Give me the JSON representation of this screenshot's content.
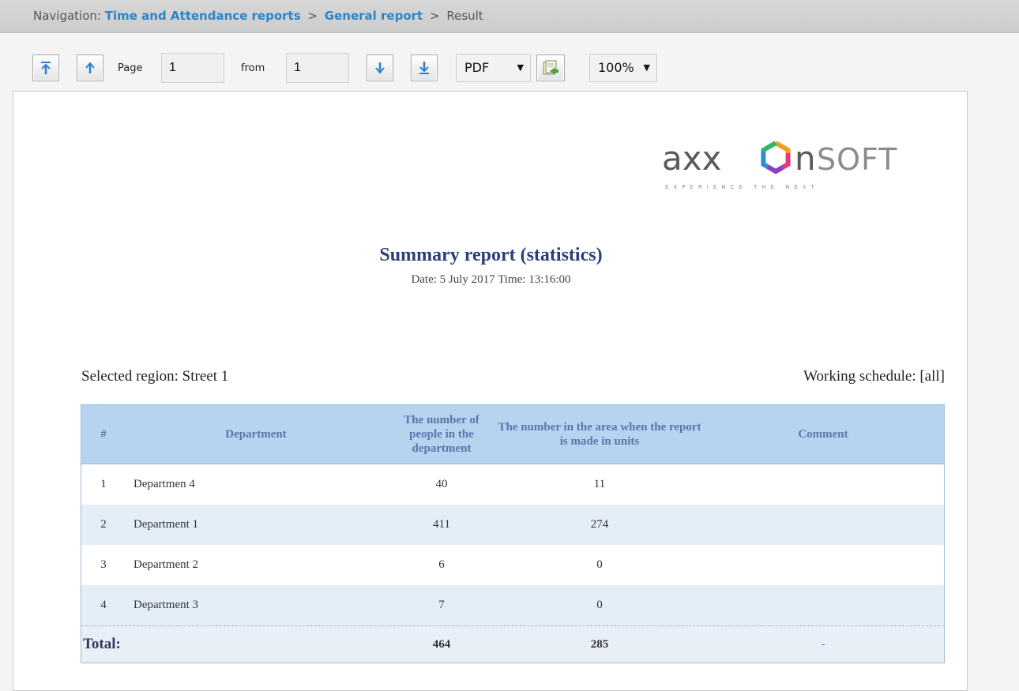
{
  "navigation": {
    "prefix": "Navigation:",
    "crumbs": [
      "Time and Attendance reports",
      "General report"
    ],
    "separator": ">",
    "current": "Result"
  },
  "toolbar": {
    "first_page_icon": "first-page-icon",
    "prev_page_icon": "previous-page-icon",
    "page_label": "Page",
    "page_value": "1",
    "from_label": "from",
    "total_pages": "1",
    "next_page_icon": "next-page-icon",
    "last_page_icon": "last-page-icon",
    "export_format": "PDF",
    "export_icon": "export-icon",
    "zoom": "100%",
    "dropdown_arrow": "▼"
  },
  "report": {
    "logo": {
      "text": "AXXONSOFT",
      "tagline": "EXPERIENCE THE NEXT"
    },
    "title": "Summary report (statistics)",
    "date_line": "Date: 5 July 2017 Time: 13:16:00",
    "region": "Selected region: Street 1",
    "schedule": "Working schedule: [all]",
    "table": {
      "headers": {
        "num": "#",
        "department": "Department",
        "people": "The number of people in the department",
        "in_area": "The number in the area when the report is made in units",
        "comment": "Comment"
      },
      "rows": [
        {
          "num": "1",
          "department": "Departmen 4",
          "people": "40",
          "in_area": "11",
          "comment": ""
        },
        {
          "num": "2",
          "department": "Department 1",
          "people": "411",
          "in_area": "274",
          "comment": ""
        },
        {
          "num": "3",
          "department": "Department 2",
          "people": "6",
          "in_area": "0",
          "comment": ""
        },
        {
          "num": "4",
          "department": "Department 3",
          "people": "7",
          "in_area": "0",
          "comment": ""
        }
      ],
      "total": {
        "label": "Total:",
        "people": "464",
        "in_area": "285",
        "comment": "-"
      }
    }
  },
  "colors": {
    "link": "#2a85c9",
    "header_bg": "#b7d3ef",
    "header_text": "#5a76aa",
    "title": "#2a3f78",
    "alt_row": "#e4eef8"
  }
}
